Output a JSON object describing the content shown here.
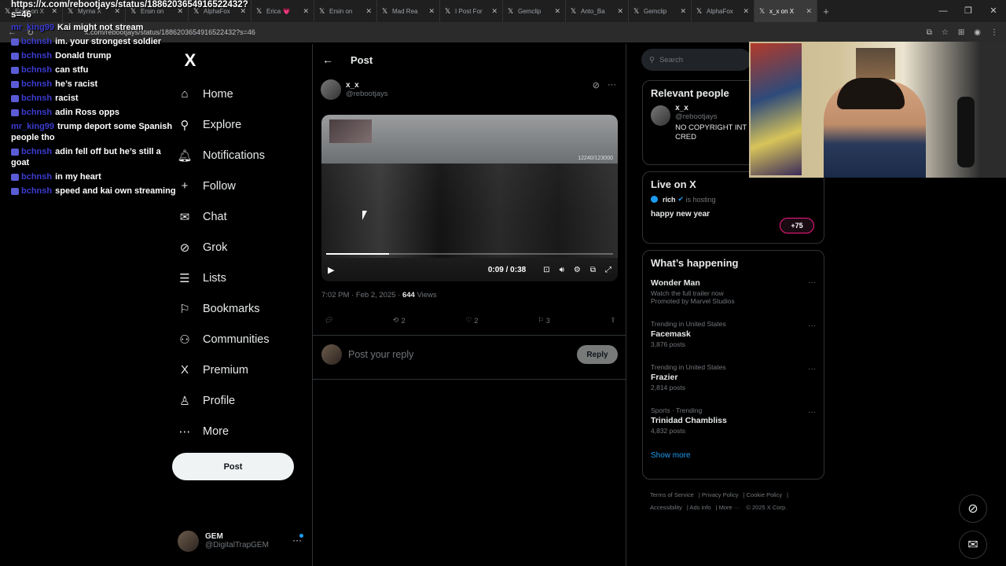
{
  "browser": {
    "tabs": [
      {
        "label": "Ersin on X"
      },
      {
        "label": "Myrna X"
      },
      {
        "label": "Ersin on"
      },
      {
        "label": "AlphaFox"
      },
      {
        "label": "Erica 💗"
      },
      {
        "label": "Ersin on"
      },
      {
        "label": "Mad Rea"
      },
      {
        "label": "I Post For"
      },
      {
        "label": "Gemclip"
      },
      {
        "label": "Anto_Ba"
      },
      {
        "label": "Gemclip"
      },
      {
        "label": "AlphaFox"
      },
      {
        "label": "x_x on X"
      }
    ],
    "url": "x.com/rebootjays/status/1886203654916522432?s=46"
  },
  "chat_overlay": {
    "url": "https://x.com/rebootjays/status/1886203654916522432?s=46",
    "messages": [
      {
        "user": "mr_king99",
        "text": "Kai might not stream"
      },
      {
        "user": "bchnsh",
        "text": "im. your strongest soldier"
      },
      {
        "user": "bchnsh",
        "text": "Donald trump"
      },
      {
        "user": "bchnsh",
        "text": "can stfu"
      },
      {
        "user": "bchnsh",
        "text": "he’s racist"
      },
      {
        "user": "bchnsh",
        "text": "racist"
      },
      {
        "user": "bchnsh",
        "text": "adin Ross opps"
      },
      {
        "user": "mr_king99",
        "text": "trump deport some Spanish people tho"
      },
      {
        "user": "bchnsh",
        "text": "adin fell off but he’s still a goat"
      },
      {
        "user": "bchnsh",
        "text": "in my heart"
      },
      {
        "user": "bchnsh",
        "text": "speed and kai own streaming"
      }
    ]
  },
  "nav": {
    "logo": "X",
    "items": [
      {
        "label": "Home",
        "icon": "home-icon",
        "glyph": "⌂"
      },
      {
        "label": "Explore",
        "icon": "search-icon",
        "glyph": "⚲"
      },
      {
        "label": "Notifications",
        "icon": "bell-icon",
        "glyph": "🔔︎"
      },
      {
        "label": "Follow",
        "icon": "add-person-icon",
        "glyph": "+"
      },
      {
        "label": "Chat",
        "icon": "mail-icon",
        "glyph": "✉"
      },
      {
        "label": "Grok",
        "icon": "grok-icon",
        "glyph": "⊘"
      },
      {
        "label": "Lists",
        "icon": "list-icon",
        "glyph": "☰"
      },
      {
        "label": "Bookmarks",
        "icon": "bookmark-icon",
        "glyph": "⚐"
      },
      {
        "label": "Communities",
        "icon": "communities-icon",
        "glyph": "⚇"
      },
      {
        "label": "Premium",
        "icon": "x-icon",
        "glyph": "X"
      },
      {
        "label": "Profile",
        "icon": "person-icon",
        "glyph": "♙"
      },
      {
        "label": "More",
        "icon": "more-icon",
        "glyph": "⋯"
      }
    ],
    "post_button": "Post",
    "account": {
      "name": "GEM",
      "handle": "@DigitalTrapGEM"
    }
  },
  "post": {
    "header_title": "Post",
    "author_name": "x_x",
    "author_handle": "@rebootjays",
    "video": {
      "current_time": "0:09",
      "duration": "0:38",
      "progress_fraction": 0.22,
      "overlay_counter": "12240/123000"
    },
    "timestamp": "7:02 PM · Feb 2, 2025 · ",
    "views_count": "644",
    "views_label": " Views",
    "reposts": "2",
    "likes": "2",
    "bookmarks": "3",
    "reply_placeholder": "Post your reply",
    "reply_button": "Reply"
  },
  "sidebar": {
    "search_placeholder": "Search",
    "relevant_title": "Relevant people",
    "relevant_person": {
      "name": "x_x",
      "handle": "@rebootjays",
      "bio": "NO COPYRIGHT INT REMOVAL OR CRED"
    },
    "live_title": "Live on X",
    "live": {
      "host": "rich",
      "hosting_label": "is hosting",
      "title": "happy new year",
      "listeners": "+75"
    },
    "happening_title": "What’s happening",
    "trends": [
      {
        "context": "",
        "name": "Wonder Man",
        "count": "Watch the full trailer now",
        "promo": "Promoted by Marvel Studios"
      },
      {
        "context": "Trending in United States",
        "name": "Facemask",
        "count": "3,876 posts",
        "promo": ""
      },
      {
        "context": "Trending in United States",
        "name": "Frazier",
        "count": "2,814 posts",
        "promo": ""
      },
      {
        "context": "Sports · Trending",
        "name": "Trinidad Chambliss",
        "count": "4,832 posts",
        "promo": ""
      }
    ],
    "show_more": "Show more",
    "footer": [
      "Terms of Service",
      "Privacy Policy",
      "Cookie Policy",
      "Accessibility",
      "Ads info",
      "More ···",
      "© 2025 X Corp."
    ]
  },
  "colors": {
    "accent": "#1d9bf0",
    "background": "#000000",
    "border": "#2f3336",
    "muted": "#71767b"
  }
}
